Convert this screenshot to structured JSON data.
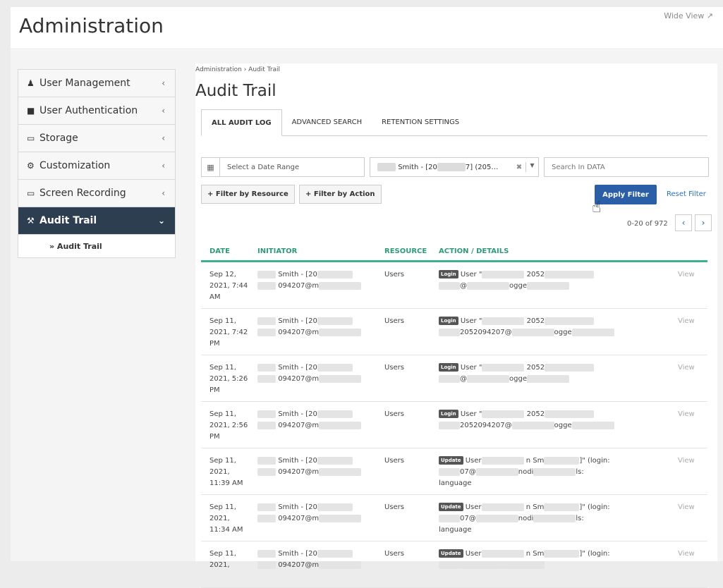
{
  "header": {
    "title": "Administration",
    "wide_view": "Wide View ↗"
  },
  "sidebar": {
    "items": [
      {
        "label": "User Management",
        "icon": "user-icon",
        "glyph": "♟"
      },
      {
        "label": "User Authentication",
        "icon": "lock-icon",
        "glyph": "■"
      },
      {
        "label": "Storage",
        "icon": "drive-icon",
        "glyph": "▭"
      },
      {
        "label": "Customization",
        "icon": "gears-icon",
        "glyph": "⚙"
      },
      {
        "label": "Screen Recording",
        "icon": "monitor-icon",
        "glyph": "▭"
      },
      {
        "label": "Audit Trail",
        "icon": "gavel-icon",
        "glyph": "⚒"
      }
    ],
    "sub_item": "» Audit Trail",
    "chevron_closed": "‹",
    "chevron_open": "⌄"
  },
  "main": {
    "breadcrumb": "Administration › Audit Trail",
    "title": "Audit Trail",
    "tabs": [
      "ALL AUDIT LOG",
      "ADVANCED SEARCH",
      "RETENTION SETTINGS"
    ],
    "date_placeholder": "Select a Date Range",
    "user_select_value": "Smith - [20",
    "user_select_tail": "7] (205…",
    "search_placeholder": "Search In DATA",
    "filter_resource": "+ Filter by Resource",
    "filter_action": "+ Filter by Action",
    "apply": "Apply Filter",
    "reset": "Reset Filter",
    "paging": "0-20 of 972",
    "prev": "‹",
    "next": "›"
  },
  "table": {
    "columns": [
      "DATE",
      "INITIATOR",
      "RESOURCE",
      "ACTION / DETAILS",
      ""
    ],
    "rows": [
      {
        "date": "Sep 12, 2021, 7:44 AM",
        "init1": "Smith - [20",
        "init2": "094207@m",
        "resource": "Users",
        "badge": "Login",
        "act1": "User \"",
        "act1b": "2052",
        "act2": "@",
        "act2b": "ogge",
        "act3": "",
        "view": "View"
      },
      {
        "date": "Sep 11, 2021, 7:42 PM",
        "init1": "Smith - [20",
        "init2": "094207@m",
        "resource": "Users",
        "badge": "Login",
        "act1": "User \"",
        "act1b": "2052",
        "act2": "2052094207@",
        "act2b": "ogge",
        "act3": "",
        "view": "View"
      },
      {
        "date": "Sep 11, 2021, 5:26 PM",
        "init1": "Smith - [20",
        "init2": "094207@m",
        "resource": "Users",
        "badge": "Login",
        "act1": "User \"",
        "act1b": "2052",
        "act2": "@",
        "act2b": "ogge",
        "act3": "",
        "view": "View"
      },
      {
        "date": "Sep 11, 2021, 2:56 PM",
        "init1": "Smith - [20",
        "init2": "094207@m",
        "resource": "Users",
        "badge": "Login",
        "act1": "User \"",
        "act1b": "2052",
        "act2": "2052094207@",
        "act2b": "ogge",
        "act3": "",
        "view": "View"
      },
      {
        "date": "Sep 11, 2021, 11:39 AM",
        "init1": "Smith - [20",
        "init2": "094207@m",
        "resource": "Users",
        "badge": "Update",
        "act1": "User",
        "act1b": "n Sm",
        "act1c": "]\" (login:",
        "act2": "07@",
        "act2b": "nodi",
        "act2c": "ls:",
        "act3": "language",
        "view": "View"
      },
      {
        "date": "Sep 11, 2021, 11:34 AM",
        "init1": "Smith - [20",
        "init2": "094207@m",
        "resource": "Users",
        "badge": "Update",
        "act1": "User",
        "act1b": "n Sm",
        "act1c": "]\" (login:",
        "act2": "07@",
        "act2b": "nodi",
        "act2c": "ls:",
        "act3": "language",
        "view": "View"
      },
      {
        "date": "Sep 11, 2021,",
        "init1": "Smith - [20",
        "init2": "094207@m",
        "resource": "Users",
        "badge": "Update",
        "act1": "User",
        "act1b": "n Sm",
        "act1c": "]\" (login:",
        "act2": "",
        "act2b": "",
        "act2c": "",
        "act3": "",
        "view": "View"
      }
    ]
  }
}
